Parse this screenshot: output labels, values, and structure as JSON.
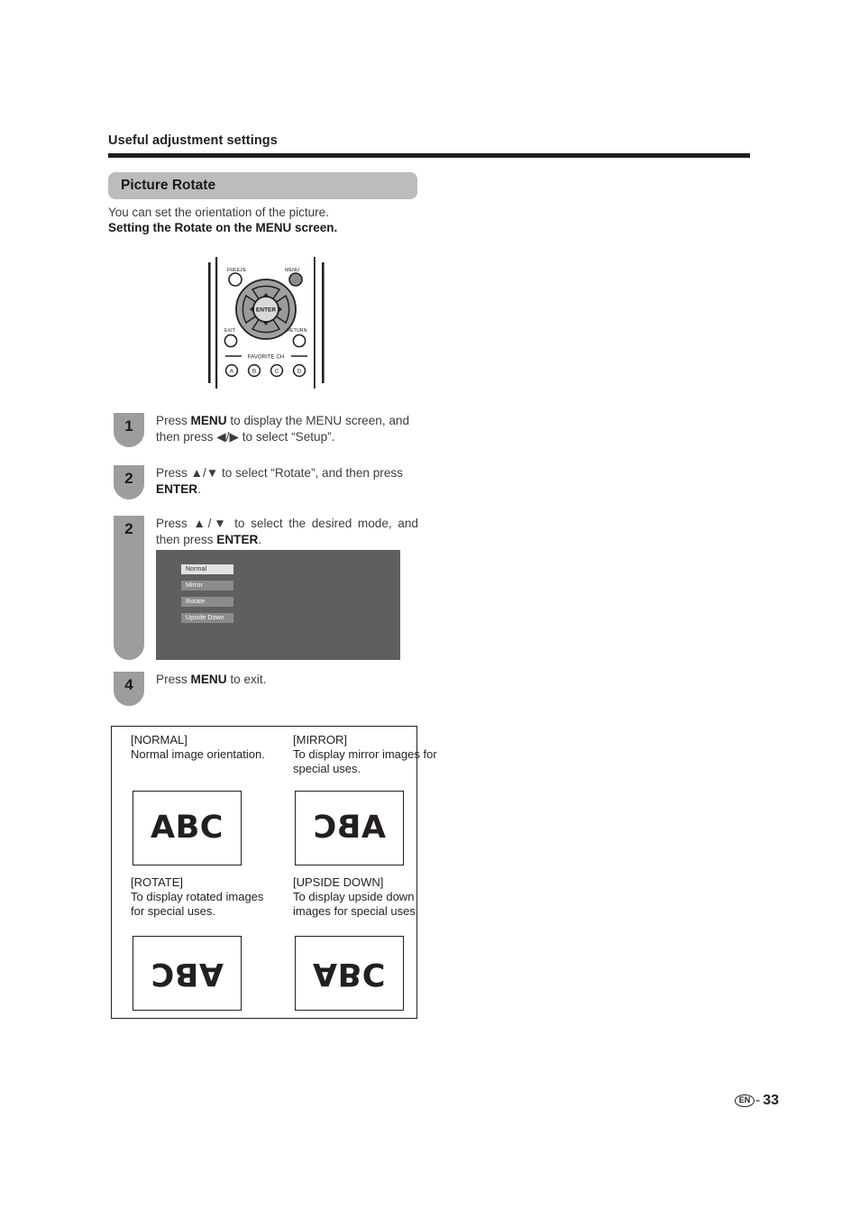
{
  "header": {
    "title": "Useful adjustment settings"
  },
  "section": {
    "title": "Picture Rotate",
    "intro_line1": "You can set the orientation of the picture.",
    "intro_line2": "Setting the Rotate on the MENU screen."
  },
  "remote": {
    "freeze_label": "FREEZE",
    "menu_label": "MENU",
    "exit_label": "EXIT",
    "return_label": "RETURN",
    "enter_label": "ENTER",
    "favorite_label": "FAVORITE CH",
    "favorite_buttons": [
      "A",
      "B",
      "C",
      "D"
    ]
  },
  "steps": [
    {
      "number": "1",
      "text_html": "Press <b>MENU</b> to display the MENU screen, and then press ◀/▶ to select “Setup”."
    },
    {
      "number": "2",
      "text_html": "Press ▲/▼ to select “Rotate”, and then press <b>ENTER</b>."
    },
    {
      "number": "2",
      "text_html": "Press ▲/▼ to select the desired mode, and then press <b>ENTER</b>."
    },
    {
      "number": "4",
      "text_html": "Press <b>MENU</b> to exit."
    }
  ],
  "osd": {
    "items": [
      {
        "label": "Normal",
        "selected": true
      },
      {
        "label": "Mirror",
        "selected": false
      },
      {
        "label": "Rotate",
        "selected": false
      },
      {
        "label": "Upside Down",
        "selected": false
      }
    ]
  },
  "orientation_table": {
    "cells": [
      {
        "title": "[NORMAL]",
        "description": "Normal image orientation.",
        "sample_text": "ABC",
        "transform": "t-normal"
      },
      {
        "title": "[MIRROR]",
        "description": "To display mirror images for special uses.",
        "sample_text": "ABC",
        "transform": "t-mirror"
      },
      {
        "title": "[ROTATE]",
        "description": "To display rotated images for special uses.",
        "sample_text": "ABC",
        "transform": "t-rotate"
      },
      {
        "title": "[UPSIDE DOWN]",
        "description": "To display upside down images for special uses.",
        "sample_text": "ABC",
        "transform": "t-upside"
      }
    ]
  },
  "footer": {
    "language_code": "EN",
    "dash": "-",
    "page_number": "33"
  }
}
